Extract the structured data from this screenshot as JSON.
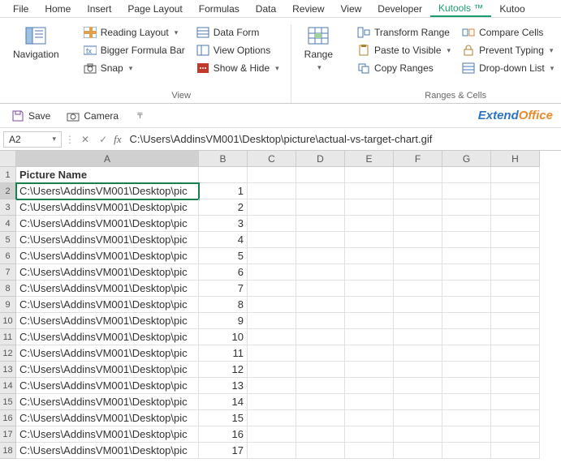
{
  "menu": [
    "File",
    "Home",
    "Insert",
    "Page Layout",
    "Formulas",
    "Data",
    "Review",
    "View",
    "Developer",
    "Kutools ™",
    "Kutoo"
  ],
  "menuActive": 9,
  "ribbon": {
    "nav": "Navigation",
    "view": {
      "readingLayout": "Reading Layout",
      "biggerFormula": "Bigger Formula Bar",
      "snap": "Snap",
      "dataForm": "Data Form",
      "viewOptions": "View Options",
      "showHide": "Show & Hide",
      "label": "View"
    },
    "range": "Range",
    "ranges": {
      "transform": "Transform Range",
      "paste": "Paste to Visible",
      "copy": "Copy Ranges",
      "compare": "Compare Cells",
      "prevent": "Prevent Typing",
      "dropdown": "Drop-down List",
      "label": "Ranges & Cells"
    }
  },
  "qat": {
    "save": "Save",
    "camera": "Camera"
  },
  "brand": {
    "p1": "Extend",
    "p2": "Office"
  },
  "namebox": "A2",
  "formula": "C:\\Users\\AddinsVM001\\Desktop\\picture\\actual-vs-target-chart.gif",
  "cols": [
    "A",
    "B",
    "C",
    "D",
    "E",
    "F",
    "G",
    "H"
  ],
  "header": "Picture Name",
  "rows": [
    {
      "n": 1,
      "a": "Picture Name",
      "b": ""
    },
    {
      "n": 2,
      "a": "C:\\Users\\AddinsVM001\\Desktop\\pic",
      "b": "1"
    },
    {
      "n": 3,
      "a": "C:\\Users\\AddinsVM001\\Desktop\\pic",
      "b": "2"
    },
    {
      "n": 4,
      "a": "C:\\Users\\AddinsVM001\\Desktop\\pic",
      "b": "3"
    },
    {
      "n": 5,
      "a": "C:\\Users\\AddinsVM001\\Desktop\\pic",
      "b": "4"
    },
    {
      "n": 6,
      "a": "C:\\Users\\AddinsVM001\\Desktop\\pic",
      "b": "5"
    },
    {
      "n": 7,
      "a": "C:\\Users\\AddinsVM001\\Desktop\\pic",
      "b": "6"
    },
    {
      "n": 8,
      "a": "C:\\Users\\AddinsVM001\\Desktop\\pic",
      "b": "7"
    },
    {
      "n": 9,
      "a": "C:\\Users\\AddinsVM001\\Desktop\\pic",
      "b": "8"
    },
    {
      "n": 10,
      "a": "C:\\Users\\AddinsVM001\\Desktop\\pic",
      "b": "9"
    },
    {
      "n": 11,
      "a": "C:\\Users\\AddinsVM001\\Desktop\\pic",
      "b": "10"
    },
    {
      "n": 12,
      "a": "C:\\Users\\AddinsVM001\\Desktop\\pic",
      "b": "11"
    },
    {
      "n": 13,
      "a": "C:\\Users\\AddinsVM001\\Desktop\\pic",
      "b": "12"
    },
    {
      "n": 14,
      "a": "C:\\Users\\AddinsVM001\\Desktop\\pic",
      "b": "13"
    },
    {
      "n": 15,
      "a": "C:\\Users\\AddinsVM001\\Desktop\\pic",
      "b": "14"
    },
    {
      "n": 16,
      "a": "C:\\Users\\AddinsVM001\\Desktop\\pic",
      "b": "15"
    },
    {
      "n": 17,
      "a": "C:\\Users\\AddinsVM001\\Desktop\\pic",
      "b": "16"
    },
    {
      "n": 18,
      "a": "C:\\Users\\AddinsVM001\\Desktop\\pic",
      "b": "17"
    }
  ]
}
